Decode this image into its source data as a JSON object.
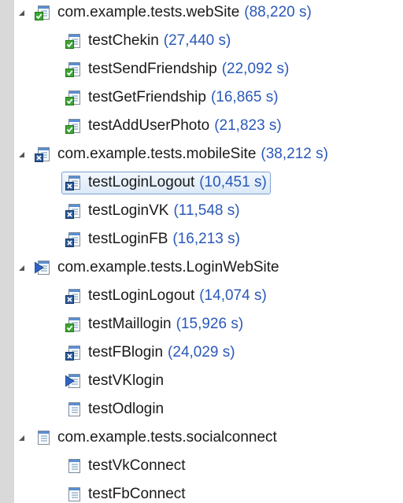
{
  "suites": [
    {
      "label": "com.example.tests.webSite",
      "time": "(88,220 s)",
      "status": "pass",
      "expanded": true,
      "tests": [
        {
          "label": "testChekin",
          "time": "(27,440 s)",
          "status": "pass"
        },
        {
          "label": "testSendFriendship",
          "time": "(22,092 s)",
          "status": "pass"
        },
        {
          "label": "testGetFriendship",
          "time": "(16,865 s)",
          "status": "pass"
        },
        {
          "label": "testAddUserPhoto",
          "time": "(21,823 s)",
          "status": "pass"
        }
      ]
    },
    {
      "label": "com.example.tests.mobileSite",
      "time": "(38,212 s)",
      "status": "error",
      "expanded": true,
      "tests": [
        {
          "label": "testLoginLogout",
          "time": "(10,451 s)",
          "status": "error",
          "selected": true
        },
        {
          "label": "testLoginVK",
          "time": "(11,548 s)",
          "status": "error"
        },
        {
          "label": "testLoginFB",
          "time": "(16,213 s)",
          "status": "error"
        }
      ]
    },
    {
      "label": "com.example.tests.LoginWebSite",
      "time": "",
      "status": "running",
      "expanded": true,
      "tests": [
        {
          "label": "testLoginLogout",
          "time": "(14,074 s)",
          "status": "error"
        },
        {
          "label": "testMaillogin",
          "time": "(15,926 s)",
          "status": "pass"
        },
        {
          "label": "testFBlogin",
          "time": "(24,029 s)",
          "status": "error"
        },
        {
          "label": "testVKlogin",
          "time": "",
          "status": "running"
        },
        {
          "label": "testOdlogin",
          "time": "",
          "status": "pending"
        }
      ]
    },
    {
      "label": "com.example.tests.socialconnect",
      "time": "",
      "status": "pending",
      "expanded": true,
      "tests": [
        {
          "label": "testVkConnect",
          "time": "",
          "status": "pending"
        },
        {
          "label": "testFbConnect",
          "time": "",
          "status": "pending"
        }
      ]
    }
  ],
  "colors": {
    "time_text": "#2a59b8",
    "pass_badge": "#3fa535",
    "error_badge": "#2c5b9c",
    "running_arrow": "#2f63c4",
    "selection_border": "#7da2ce"
  }
}
